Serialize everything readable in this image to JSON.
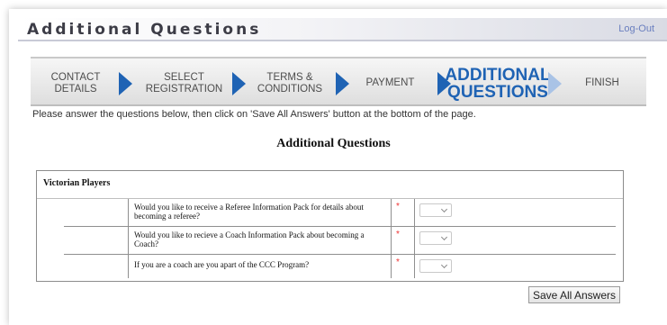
{
  "header": {
    "title": "Additional Questions",
    "logout_label": "Log-Out"
  },
  "wizard": {
    "steps": [
      {
        "line1": "CONTACT",
        "line2": "DETAILS"
      },
      {
        "line1": "SELECT",
        "line2": "REGISTRATION"
      },
      {
        "line1": "TERMS &",
        "line2": "CONDITIONS"
      },
      {
        "line1": "PAYMENT",
        "line2": ""
      },
      {
        "line1": "ADDITIONAL",
        "line2": "QUESTIONS"
      },
      {
        "line1": "FINISH",
        "line2": ""
      }
    ],
    "active_step": 5
  },
  "instructions": "Please answer the questions below, then click on 'Save All Answers' button at the bottom of the page.",
  "section_title": "Additional Questions",
  "group": {
    "label": "Victorian Players",
    "questions": [
      {
        "text": "Would you like to receive a Referee Information Pack for details about becoming a referee?",
        "required_mark": "*",
        "selected": ""
      },
      {
        "text": "Would you like to recieve a Coach Information Pack about becoming a Coach?",
        "required_mark": "*",
        "selected": ""
      },
      {
        "text": "If you are a coach are you apart of the CCC Program?",
        "required_mark": "*",
        "selected": ""
      }
    ]
  },
  "save_button_label": "Save All Answers",
  "colors": {
    "accent": "#1f63b4",
    "required": "#e33333",
    "logout": "#6a7fbf"
  }
}
